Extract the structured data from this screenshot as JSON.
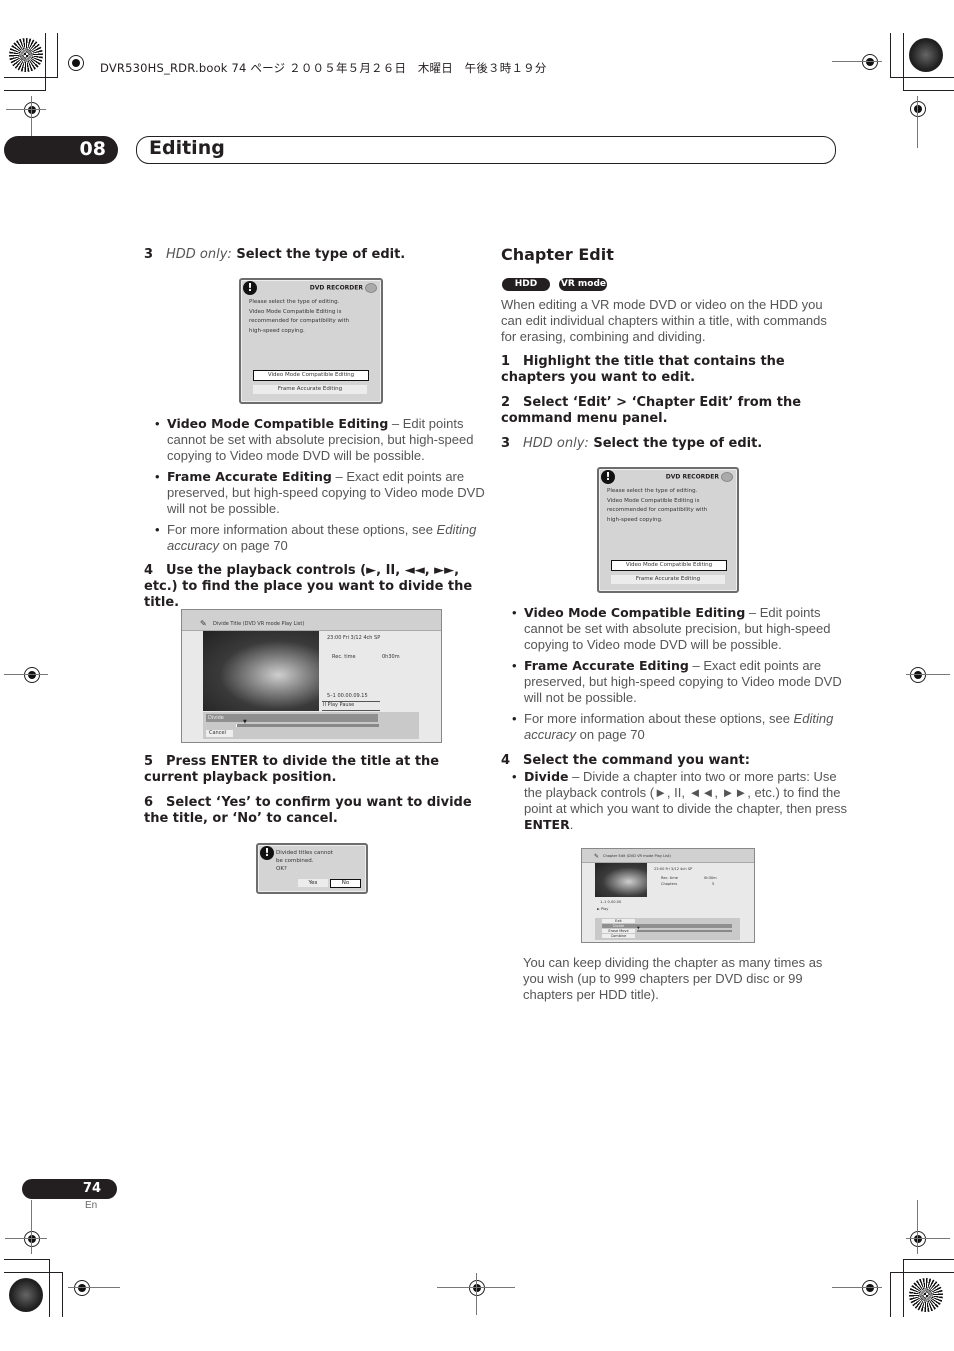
{
  "print_header": "DVR530HS_RDR.book  74 ページ  ２００５年５月２６日　木曜日　午後３時１９分",
  "chapter": {
    "number": "08",
    "title": "Editing"
  },
  "left": {
    "step3": {
      "num": "3",
      "qualifier": "HDD only:",
      "text": "Select the type of edit."
    },
    "dialog1": {
      "header": "DVD RECORDER",
      "message": [
        "Please select the type of editing.",
        "Video Mode Compatible Editing is",
        "recommended for compatibility with",
        "high-speed copying."
      ],
      "options": [
        "Video Mode Compatible Editing",
        "Frame Accurate Editing"
      ],
      "selected": "Video Mode Compatible Editing"
    },
    "bullets": [
      {
        "bold": "Video Mode Compatible Editing",
        "text": " – Edit points cannot be set with absolute precision, but high-speed copying to Video mode DVD will be possible."
      },
      {
        "bold": "Frame Accurate Editing",
        "text": " – Exact edit points are preserved, but high-speed copying to Video mode DVD will not be possible."
      },
      {
        "text_before": "For more information about these options, see ",
        "italic": "Editing accuracy",
        "text_after": " on page 70"
      }
    ],
    "step4": {
      "num": "4",
      "text": "Use the playback controls (►, II, ◄◄, ►►, etc.) to find the place you want to divide the title."
    },
    "divide_screen": {
      "title": "Divide Title  (DVD VR mode Play List)",
      "info_line": "23:00 Fri  3/12  4ch  SP",
      "rec_time_label": "Rec. time",
      "rec_time_value": "0h30m",
      "position": "5–1     00.00.09.15",
      "status": "II Play Pause",
      "menu": [
        "Divide",
        "Cancel"
      ],
      "selected": "Divide"
    },
    "step5": {
      "num": "5",
      "text": "Press ENTER to divide the title at the current playback position."
    },
    "step6": {
      "num": "6",
      "text": "Select ‘Yes’ to confirm you want to divide the title, or ‘No’ to cancel."
    },
    "confirm_dialog": {
      "message": [
        "Divided titles cannot",
        "be combined.",
        "OK?"
      ],
      "yes": "Yes",
      "no": "No",
      "selected": "No"
    }
  },
  "right": {
    "heading": "Chapter Edit",
    "badges": [
      "HDD",
      "VR mode"
    ],
    "intro": "When editing a VR mode DVD or video on the HDD you can edit individual chapters within a title, with commands for erasing, combining and dividing.",
    "step1": {
      "num": "1",
      "text": "Highlight the title that contains the chapters you want to edit."
    },
    "step2": {
      "num": "2",
      "text": "Select ‘Edit’ > ‘Chapter Edit’ from the command menu panel."
    },
    "step3": {
      "num": "3",
      "qualifier": "HDD only:",
      "text": "Select the type of edit."
    },
    "dialog2": {
      "header": "DVD RECORDER",
      "message": [
        "Please select the type of editing.",
        "Video Mode Compatible Editing is",
        "recommended for compatibility with",
        "high-speed copying."
      ],
      "options": [
        "Video Mode Compatible Editing",
        "Frame Accurate Editing"
      ],
      "selected": "Video Mode Compatible Editing"
    },
    "bullets": [
      {
        "bold": "Video Mode Compatible Editing",
        "text": " – Edit points cannot be set with absolute precision, but high-speed copying to Video mode DVD will be possible."
      },
      {
        "bold": "Frame Accurate Editing",
        "text": " – Exact edit points are preserved, but high-speed copying to Video mode DVD will not be possible."
      },
      {
        "text_before": "For more information about these options, see ",
        "italic": "Editing accuracy",
        "text_after": " on page 70"
      }
    ],
    "step4": {
      "num": "4",
      "text": "Select the command you want:"
    },
    "divide_bullet": {
      "bold": "Divide",
      "text": " – Divide a chapter into two or more parts: Use the playback controls (►, II, ◄◄, ►►, etc.) to find the point at which you want to divide the chapter, then press ",
      "bold2": "ENTER",
      "end": "."
    },
    "chapter_screen": {
      "title": "Chapter Edit (DVD VR mode Play List)",
      "info_line": "23:00 Fri  3/12  4ch  SP",
      "rec_time_label": "Rec. time",
      "rec_time_value": "0h30m",
      "chapters_label": "Chapters",
      "chapters_value": "5",
      "position": "1–1      0.00.00",
      "status": "► Play",
      "menu": [
        "Exit",
        "Divide",
        "Erase Move",
        "Combine"
      ],
      "selected": "Divide"
    },
    "closing": "You can keep dividing the chapter as many times as you wish (up to 999 chapters per DVD disc or 99 chapters per HDD title)."
  },
  "footer": {
    "page": "74",
    "lang": "En"
  }
}
